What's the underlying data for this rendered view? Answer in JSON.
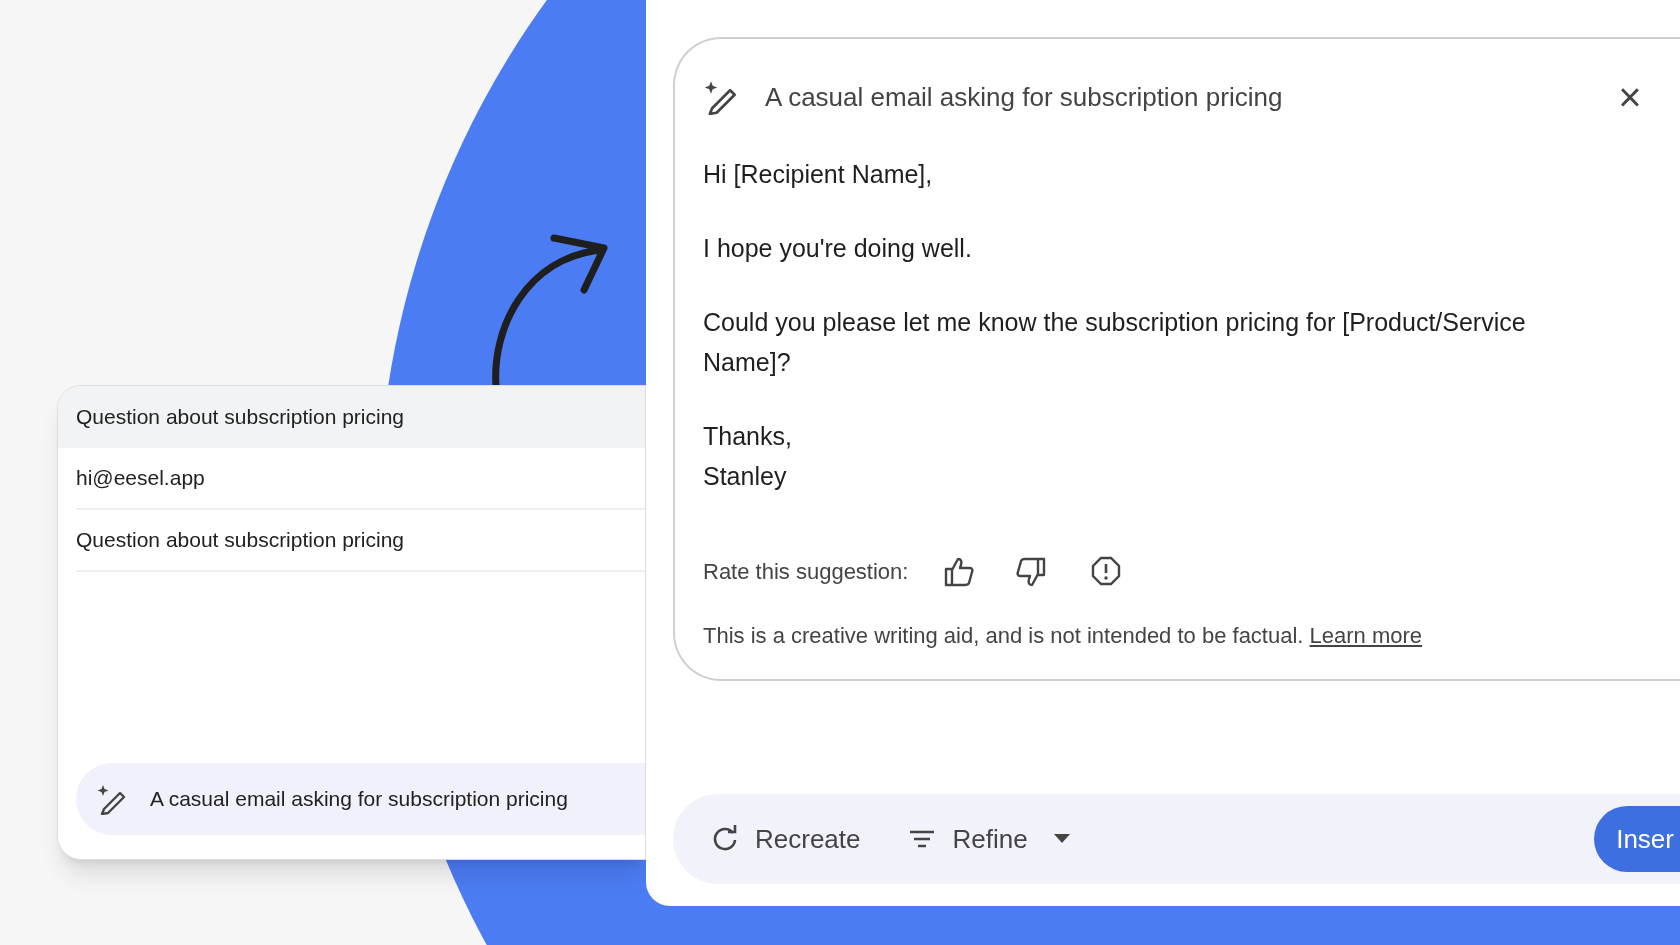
{
  "compose_panel": {
    "header": "Question about subscription pricing",
    "fields": [
      {
        "value": "hi@eesel.app"
      },
      {
        "value": "Question about subscription pricing"
      }
    ],
    "prompt": "A casual email asking for subscription pricing"
  },
  "suggestion_panel": {
    "prompt_title": "A casual email asking for subscription pricing",
    "close": "×",
    "paragraphs": [
      [
        "Hi [Recipient Name],"
      ],
      [
        "I hope you're doing well."
      ],
      [
        "Could you please let me know the subscription pricing for [Product/Service Name]?"
      ],
      [
        "Thanks,",
        "Stanley"
      ]
    ],
    "rating_label": "Rate this suggestion:",
    "disclaimer": "This is a creative writing aid, and is not intended to be factual.",
    "learn_more": "Learn more",
    "actions": [
      {
        "kind": "recreate",
        "label": "Recreate"
      },
      {
        "kind": "refine",
        "label": "Refine"
      }
    ],
    "insert_button": "Inser"
  }
}
